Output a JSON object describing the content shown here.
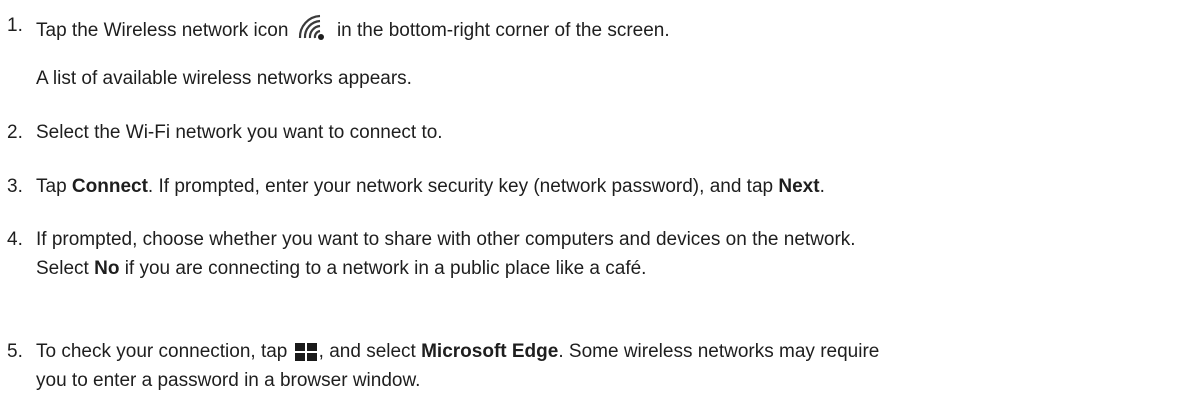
{
  "steps": [
    {
      "number": "1.",
      "before_icon": "Tap the Wireless network icon",
      "icon": "wifi-icon",
      "after_icon": "in the bottom-right corner of the screen.",
      "note": "A list of available wireless networks appears."
    },
    {
      "number": "2.",
      "text": "Select the Wi-Fi network you want to connect to."
    },
    {
      "number": "3.",
      "part1": "Tap",
      "bold1": "Connect",
      "part2": ". If prompted, enter your network security key (network password), and tap",
      "bold2": "Next",
      "part3": "."
    },
    {
      "number": "4.",
      "line1": "If prompted, choose whether you want to share with other computers and devices on the network.",
      "line2_part1": "Select",
      "line2_bold": "No",
      "line2_part2": "if you are connecting to a network in a public place like a café."
    },
    {
      "number": "5.",
      "part1": "To check your connection, tap",
      "icon": "windows-start-icon",
      "part2": ", and select",
      "bold": "Microsoft Edge",
      "part3": ". Some wireless networks may require",
      "line2": "you to enter a password in a browser window."
    }
  ]
}
